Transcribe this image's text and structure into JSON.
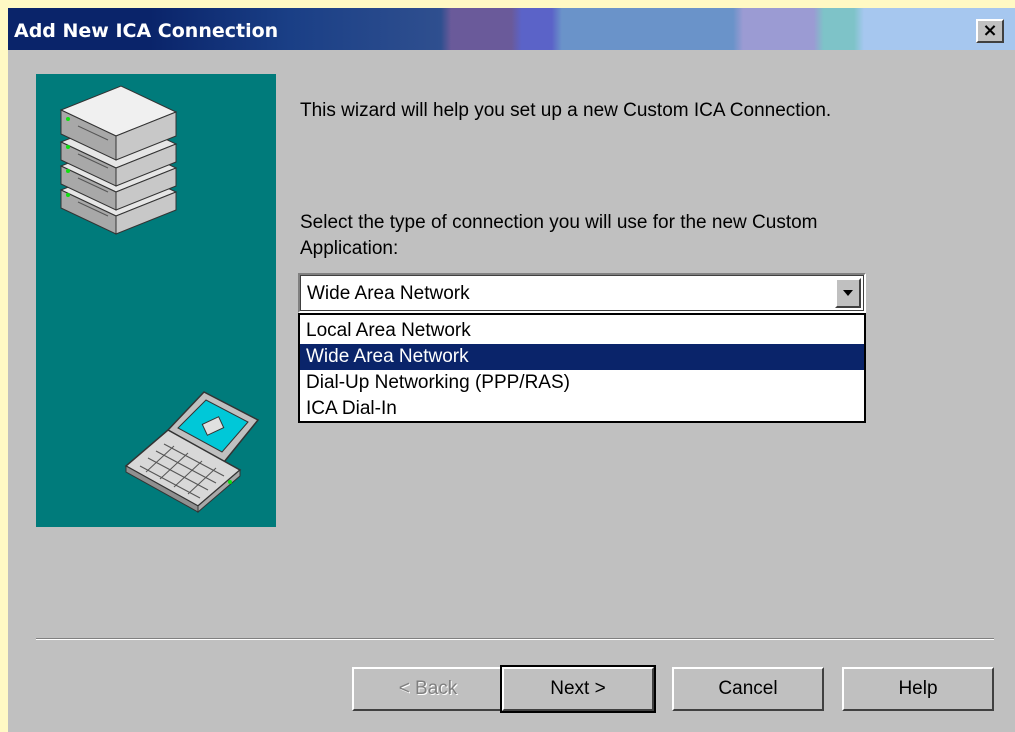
{
  "window": {
    "title": "Add New ICA Connection",
    "close_label": "×"
  },
  "wizard": {
    "intro_text": "This wizard will help you set up a new Custom ICA Connection.",
    "prompt_text": "Select the type of connection you will use for the new Custom Application:",
    "connection_type": {
      "selected": "Wide Area Network",
      "options": [
        "Local Area Network",
        "Wide Area Network",
        "Dial-Up Networking (PPP/RAS)",
        "ICA Dial-In"
      ],
      "highlighted_index": 1
    }
  },
  "buttons": {
    "back": "< Back",
    "next": "Next >",
    "cancel": "Cancel",
    "help": "Help"
  },
  "icons": {
    "server": "server-stack-icon",
    "laptop": "laptop-icon",
    "dropdown_arrow": "triangle-down-icon"
  },
  "colors": {
    "title_bar_start": "#0a246a",
    "side_panel": "#007b7b",
    "selection": "#0a246a",
    "dialog_face": "#c0c0c0"
  }
}
